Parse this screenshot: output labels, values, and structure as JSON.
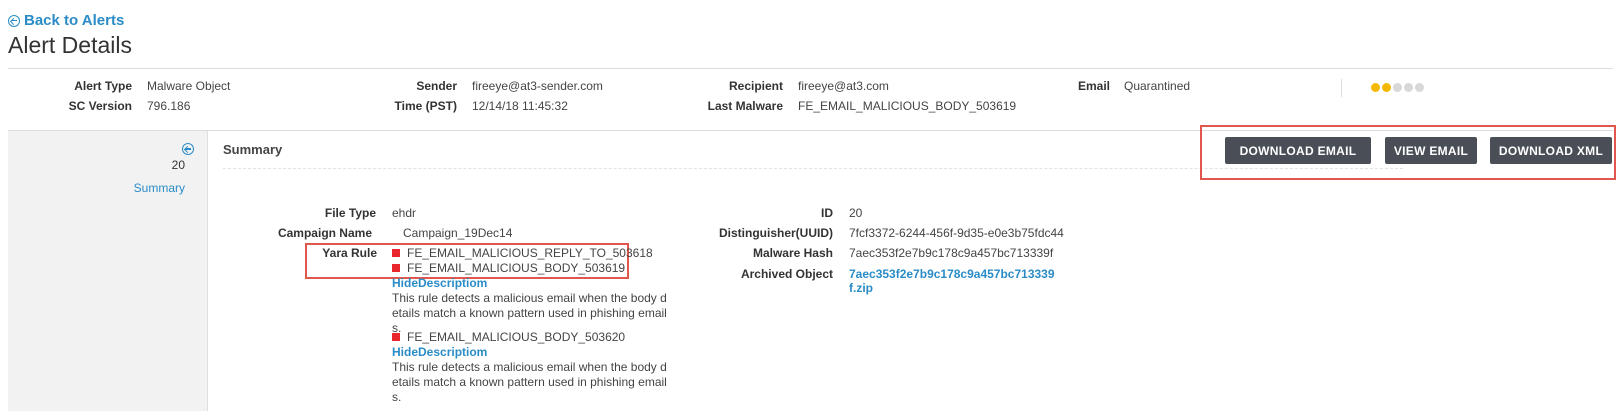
{
  "nav": {
    "back_label": "Back to Alerts"
  },
  "page": {
    "title": "Alert Details"
  },
  "header": {
    "alert_type_label": "Alert Type",
    "alert_type": "Malware Object",
    "sc_version_label": "SC Version",
    "sc_version": "796.186",
    "sender_label": "Sender",
    "sender": "fireeye@at3-sender.com",
    "time_label": "Time (PST)",
    "time": "12/14/18 11:45:32",
    "recipient_label": "Recipient",
    "recipient": "fireeye@at3.com",
    "last_malware_label": "Last Malware",
    "last_malware": "FE_EMAIL_MALICIOUS_BODY_503619",
    "email_label": "Email",
    "email": "Quarantined",
    "severity": {
      "level": 2,
      "of": 5,
      "active_color": "#f5b800",
      "inactive_color": "#d8d8d8"
    }
  },
  "left_panel": {
    "number": "20",
    "summary_link": "Summary"
  },
  "summary": {
    "title": "Summary",
    "buttons": {
      "download_email": "DOWNLOAD EMAIL",
      "view_email": "VIEW EMAIL",
      "download_xml": "DOWNLOAD XML"
    }
  },
  "details": {
    "file_type_label": "File Type",
    "file_type": "ehdr",
    "campaign_name_label": "Campaign Name",
    "campaign_name": "Campaign_19Dec14",
    "yara_rule_label": "Yara Rule",
    "yara_rules": [
      "FE_EMAIL_MALICIOUS_REPLY_TO_503618",
      "FE_EMAIL_MALICIOUS_BODY_503619",
      "FE_EMAIL_MALICIOUS_BODY_503620"
    ],
    "hide_description": "HideDescriptiom",
    "rule_description": "This rule detects a malicious email when the body details match a known pattern used in phishing emails.",
    "id_label": "ID",
    "id": "20",
    "distinguisher_label": "Distinguisher(UUID)",
    "distinguisher": "7fcf3372-6244-456f-9d35-e0e3b75fdc44",
    "malware_hash_label": "Malware Hash",
    "malware_hash": "7aec353f2e7b9c178c9a457bc713339f",
    "archived_object_label": "Archived Object",
    "archived_object": "7aec353f2e7b9c178c9a457bc713339f.zip"
  }
}
